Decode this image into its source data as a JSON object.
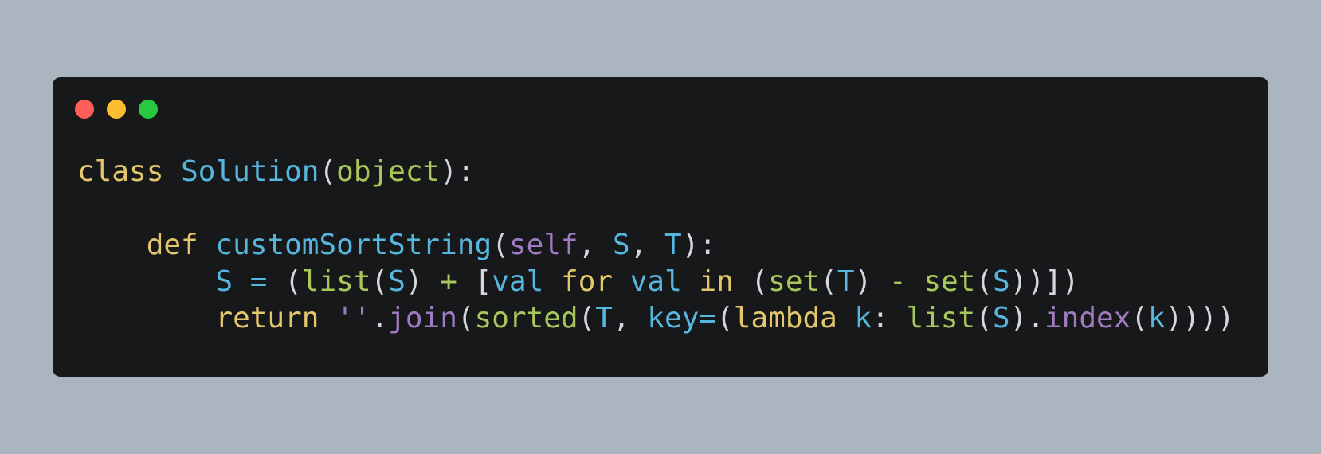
{
  "theme": {
    "background": "#abb5bf",
    "window": "#17181a",
    "traffic_red": "#fe5f58",
    "traffic_yellow": "#febc2f",
    "traffic_green": "#28c840"
  },
  "syntax_colors": {
    "keyword": "#e5c76b",
    "class_name": "#56b6dd",
    "function_name": "#56b6dd",
    "builtin": "#a6c85b",
    "self": "#a17bc2",
    "variable": "#56b6dd",
    "string": "#a17bc2",
    "punctuation": "#d4d7dc",
    "operator": "#a6c85b"
  },
  "window_controls": [
    {
      "name": "close",
      "color_key": "traffic_red"
    },
    {
      "name": "minimize",
      "color_key": "traffic_yellow"
    },
    {
      "name": "maximize",
      "color_key": "traffic_green"
    }
  ],
  "code_lines": [
    [
      {
        "t": "class",
        "c": "keyword"
      },
      {
        "t": " ",
        "c": "punctuation"
      },
      {
        "t": "Solution",
        "c": "class_name"
      },
      {
        "t": "(",
        "c": "punctuation"
      },
      {
        "t": "object",
        "c": "builtin"
      },
      {
        "t": "):",
        "c": "punctuation"
      }
    ],
    [],
    [
      {
        "t": "    ",
        "c": "punctuation"
      },
      {
        "t": "def",
        "c": "keyword"
      },
      {
        "t": " ",
        "c": "punctuation"
      },
      {
        "t": "customSortString",
        "c": "function_name"
      },
      {
        "t": "(",
        "c": "punctuation"
      },
      {
        "t": "self",
        "c": "self"
      },
      {
        "t": ", ",
        "c": "punctuation"
      },
      {
        "t": "S",
        "c": "variable"
      },
      {
        "t": ", ",
        "c": "punctuation"
      },
      {
        "t": "T",
        "c": "variable"
      },
      {
        "t": "):",
        "c": "punctuation"
      }
    ],
    [
      {
        "t": "        ",
        "c": "punctuation"
      },
      {
        "t": "S",
        "c": "variable"
      },
      {
        "t": " ",
        "c": "punctuation"
      },
      {
        "t": "=",
        "c": "variable"
      },
      {
        "t": " (",
        "c": "punctuation"
      },
      {
        "t": "list",
        "c": "builtin"
      },
      {
        "t": "(",
        "c": "punctuation"
      },
      {
        "t": "S",
        "c": "variable"
      },
      {
        "t": ") ",
        "c": "punctuation"
      },
      {
        "t": "+",
        "c": "operator"
      },
      {
        "t": " [",
        "c": "punctuation"
      },
      {
        "t": "val",
        "c": "variable"
      },
      {
        "t": " ",
        "c": "punctuation"
      },
      {
        "t": "for",
        "c": "keyword"
      },
      {
        "t": " ",
        "c": "punctuation"
      },
      {
        "t": "val",
        "c": "variable"
      },
      {
        "t": " ",
        "c": "punctuation"
      },
      {
        "t": "in",
        "c": "keyword"
      },
      {
        "t": " (",
        "c": "punctuation"
      },
      {
        "t": "set",
        "c": "builtin"
      },
      {
        "t": "(",
        "c": "punctuation"
      },
      {
        "t": "T",
        "c": "variable"
      },
      {
        "t": ") ",
        "c": "punctuation"
      },
      {
        "t": "-",
        "c": "operator"
      },
      {
        "t": " ",
        "c": "punctuation"
      },
      {
        "t": "set",
        "c": "builtin"
      },
      {
        "t": "(",
        "c": "punctuation"
      },
      {
        "t": "S",
        "c": "variable"
      },
      {
        "t": "))])",
        "c": "punctuation"
      }
    ],
    [
      {
        "t": "        ",
        "c": "punctuation"
      },
      {
        "t": "return",
        "c": "keyword"
      },
      {
        "t": " ",
        "c": "punctuation"
      },
      {
        "t": "''",
        "c": "string"
      },
      {
        "t": ".",
        "c": "punctuation"
      },
      {
        "t": "join",
        "c": "self"
      },
      {
        "t": "(",
        "c": "punctuation"
      },
      {
        "t": "sorted",
        "c": "builtin"
      },
      {
        "t": "(",
        "c": "punctuation"
      },
      {
        "t": "T",
        "c": "variable"
      },
      {
        "t": ", ",
        "c": "punctuation"
      },
      {
        "t": "key",
        "c": "variable"
      },
      {
        "t": "=",
        "c": "variable"
      },
      {
        "t": "(",
        "c": "punctuation"
      },
      {
        "t": "lambda",
        "c": "keyword"
      },
      {
        "t": " ",
        "c": "punctuation"
      },
      {
        "t": "k",
        "c": "variable"
      },
      {
        "t": ": ",
        "c": "punctuation"
      },
      {
        "t": "list",
        "c": "builtin"
      },
      {
        "t": "(",
        "c": "punctuation"
      },
      {
        "t": "S",
        "c": "variable"
      },
      {
        "t": ").",
        "c": "punctuation"
      },
      {
        "t": "index",
        "c": "self"
      },
      {
        "t": "(",
        "c": "punctuation"
      },
      {
        "t": "k",
        "c": "variable"
      },
      {
        "t": "))))",
        "c": "punctuation"
      }
    ]
  ]
}
